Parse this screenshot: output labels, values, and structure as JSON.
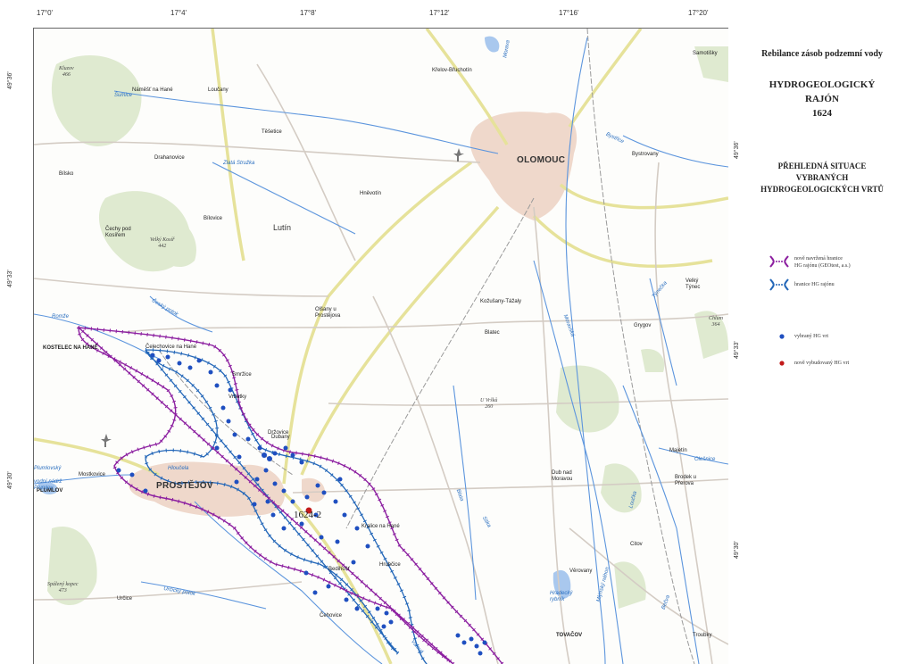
{
  "map": {
    "lon_ticks": [
      "17°0'",
      "17°4'",
      "17°8'",
      "17°12'",
      "17°16'",
      "17°20'"
    ],
    "lat_ticks_left": [
      "49°36'",
      "49°33'",
      "49°30'"
    ],
    "lat_ticks_right": [
      "49°36'",
      "49°33'",
      "49°30'"
    ],
    "cities": {
      "olomouc": "OLOMOUC",
      "prostejov": "PROSTĚJOV",
      "kostelec": "KOSTELEC NA HANÉ",
      "plumlov": "PLUMLOV",
      "lutin": "Lutín",
      "tovacov": "TOVAČOV"
    },
    "places": [
      "Samotišky",
      "Křelov-Břuchotín",
      "Bystrovany",
      "Těšetice",
      "Drahanovice",
      "Hněvotín",
      "Náměšť na Hané",
      "Loučany",
      "Bílovice",
      "Bílsko",
      "Čechy pod Kosířem",
      "Olšany u Prostějova",
      "Kožušany-Tážaly",
      "Blatec",
      "Grygov",
      "Velký Týnec",
      "Čelechovice na Hané",
      "Smržice",
      "Vrbátky",
      "Dubany",
      "Držovice",
      "Mostkovice",
      "Kralice na Hané",
      "Bedihošť",
      "Hrubčice",
      "Dub nad Moravou",
      "Majetín",
      "Brodek u Přerova",
      "Citov",
      "Věrovany",
      "Určice",
      "Čehovice",
      "Troubky"
    ],
    "rivers": [
      "Šumice",
      "Zlatá Stružka",
      "Blata",
      "Romže",
      "Český potok",
      "Morava",
      "Bystřice",
      "Týnečka",
      "Moravská",
      "Olešnice",
      "Hloučela",
      "Valová",
      "Určický potok",
      "Bečva",
      "Mlýnský náhon",
      "Loučka",
      "Sitka",
      "Plumlovský"
    ],
    "hills": [
      {
        "name": "Kluzov",
        "elev": "466"
      },
      {
        "name": "Velký Kosíř",
        "elev": "442"
      },
      {
        "name": "Chlum",
        "elev": "364"
      },
      {
        "name": "U Vršků",
        "elev": "260"
      },
      {
        "name": "Spálený kopec",
        "elev": "473"
      }
    ],
    "water": {
      "plumlov_dam": "vodní nádrž Plumlov",
      "hradecky": "Hradecký rybník"
    },
    "well_label": "1624-2"
  },
  "panel": {
    "title1": "Rebilance zásob podzemní vody",
    "title2": "HYDROGEOLOGICKÝ",
    "title3": "RAJÓN",
    "title4": "1624",
    "subtitle1": "PŘEHLEDNÁ SITUACE",
    "subtitle2": "VYBRANÝCH",
    "subtitle3": "HYDROGEOLOGICKÝCH VRTŮ",
    "legend": {
      "new_boundary_line1": "nově navržená hranice",
      "new_boundary_line2": "HG rajónu (GEOtest, a.s.)",
      "hg_boundary": "hranice HG rajónu",
      "selected_well": "vybraný HG vrt",
      "new_well": "nově vybudovaný HG vrt"
    }
  },
  "colors": {
    "old_boundary": "#2266b8",
    "new_boundary": "#8c1fa0",
    "well": "#1f4fc0",
    "new_well": "#c21a1a",
    "urban": "#f0d9cc",
    "forest": "#dfead0",
    "water": "#8fb8e8",
    "road": "#e8e5a8"
  }
}
